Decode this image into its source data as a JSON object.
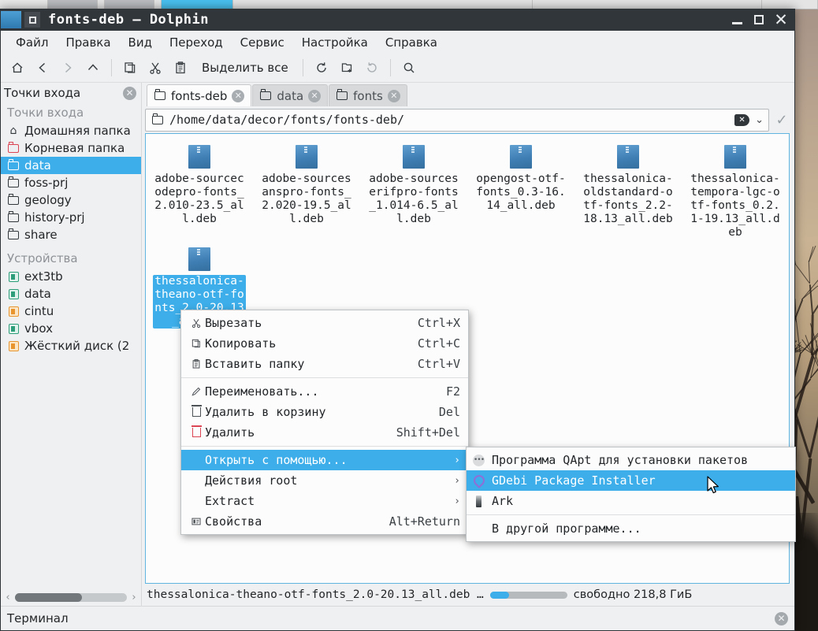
{
  "window": {
    "title": "fonts-deb — Dolphin",
    "app_icon": "dolphin-icon",
    "buttons": {
      "minimize": "_",
      "maximize": "▢",
      "close": "✕"
    }
  },
  "menubar": {
    "items": [
      "Файл",
      "Правка",
      "Вид",
      "Переход",
      "Сервис",
      "Настройка",
      "Справка"
    ]
  },
  "toolbar": {
    "items": [
      {
        "name": "home-icon",
        "glyph": "⌂",
        "dim": false
      },
      {
        "name": "back-icon",
        "glyph": "‹",
        "dim": false
      },
      {
        "name": "forward-icon",
        "glyph": "›",
        "dim": true
      },
      {
        "name": "up-icon",
        "glyph": "⌃",
        "dim": false
      }
    ],
    "items2": [
      {
        "name": "copy-icon",
        "glyph": "❐",
        "dim": false
      },
      {
        "name": "cut-icon",
        "glyph": "✂",
        "dim": false
      },
      {
        "name": "paste-icon",
        "glyph": "📋",
        "dim": false
      }
    ],
    "select_all_label": "Выделить все",
    "items3": [
      {
        "name": "reload-icon",
        "glyph": "⟳",
        "dim": false
      },
      {
        "name": "new-folder-icon",
        "glyph": "🗅",
        "dim": false
      },
      {
        "name": "undo-icon",
        "glyph": "↺",
        "dim": true
      }
    ],
    "items4": [
      {
        "name": "find-icon",
        "glyph": "⌕",
        "dim": false
      }
    ]
  },
  "sidebar": {
    "header": "Точки входа",
    "header_close": "✕",
    "sections": [
      {
        "title": "Точки входа",
        "items": [
          {
            "label": "Домашняя папка",
            "icon": "home-icon",
            "selected": false
          },
          {
            "label": "Корневая папка",
            "icon": "folder-red-icon",
            "selected": false
          },
          {
            "label": "data",
            "icon": "folder-icon",
            "selected": true
          },
          {
            "label": "foss-prj",
            "icon": "folder-icon",
            "selected": false
          },
          {
            "label": "geology",
            "icon": "folder-icon",
            "selected": false
          },
          {
            "label": "history-prj",
            "icon": "folder-icon",
            "selected": false
          },
          {
            "label": "share",
            "icon": "folder-icon",
            "selected": false
          }
        ]
      },
      {
        "title": "Устройства",
        "items": [
          {
            "label": "ext3tb",
            "icon": "drive-icon",
            "selected": false
          },
          {
            "label": "data",
            "icon": "drive-icon",
            "selected": false
          },
          {
            "label": "cintu",
            "icon": "drive-orange-icon",
            "selected": false
          },
          {
            "label": "vbox",
            "icon": "drive-icon",
            "selected": false
          },
          {
            "label": "Жёсткий диск (2",
            "icon": "drive-orange-icon",
            "selected": false
          }
        ]
      }
    ]
  },
  "tabs": [
    {
      "label": "fonts-deb",
      "active": true,
      "close": "✕"
    },
    {
      "label": "data",
      "active": false,
      "close": "✕"
    },
    {
      "label": "fonts",
      "active": false,
      "close": "✕"
    }
  ],
  "urlbar": {
    "path": "/home/data/decor/fonts/fonts-deb/",
    "folder_icon": "folder-icon",
    "clear_icon": "clear-icon",
    "dropdown_icon": "chevron-down-icon",
    "confirm_icon": "check-icon"
  },
  "files": [
    {
      "name": "adobe-sourcecodepro-fonts_2.010-23.5_all.deb",
      "selected": false
    },
    {
      "name": "adobe-sourcesanspro-fonts_2.020-19.5_all.deb",
      "selected": false
    },
    {
      "name": "adobe-sourceserifpro-fonts_1.014-6.5_all.deb",
      "selected": false
    },
    {
      "name": "opengost-otf-fonts_0.3-16.14_all.deb",
      "selected": false
    },
    {
      "name": "thessalonica-oldstandard-otf-fonts_2.2-18.13_all.deb",
      "selected": false
    },
    {
      "name": "thessalonica-tempora-lgc-otf-fonts_0.2.1-19.13_all.deb",
      "selected": false
    },
    {
      "name": "thessalonica-theano-otf-fonts_2.0-20.13_all.deb",
      "selected": true
    }
  ],
  "context_menu": {
    "groups": [
      [
        {
          "label": "Вырезать",
          "shortcut": "Ctrl+X",
          "icon": "cut-icon",
          "highlighted": false,
          "submenu": false
        },
        {
          "label": "Копировать",
          "shortcut": "Ctrl+C",
          "icon": "copy-icon",
          "highlighted": false,
          "submenu": false
        },
        {
          "label": "Вставить папку",
          "shortcut": "Ctrl+V",
          "icon": "paste-icon",
          "highlighted": false,
          "submenu": false
        }
      ],
      [
        {
          "label": "Переименовать...",
          "shortcut": "F2",
          "icon": "rename-pencil-icon",
          "highlighted": false,
          "submenu": false
        },
        {
          "label": "Удалить в корзину",
          "shortcut": "Del",
          "icon": "trash-icon",
          "highlighted": false,
          "submenu": false
        },
        {
          "label": "Удалить",
          "shortcut": "Shift+Del",
          "icon": "delete-red-trash-icon",
          "highlighted": false,
          "submenu": false
        }
      ],
      [
        {
          "label": "Открыть с помощью...",
          "shortcut": "",
          "icon": "",
          "highlighted": true,
          "submenu": true
        },
        {
          "label": "Действия root",
          "shortcut": "",
          "icon": "",
          "highlighted": false,
          "submenu": true
        },
        {
          "label": "Extract",
          "shortcut": "",
          "icon": "",
          "highlighted": false,
          "submenu": true
        },
        {
          "label": "Свойства",
          "shortcut": "Alt+Return",
          "icon": "properties-icon",
          "highlighted": false,
          "submenu": false
        }
      ]
    ]
  },
  "submenu": {
    "groups": [
      [
        {
          "label": "Программа QApt для установки пакетов",
          "icon": "qapt-icon",
          "highlighted": false
        },
        {
          "label": "GDebi Package Installer",
          "icon": "gdebi-icon",
          "highlighted": true
        },
        {
          "label": "Ark",
          "icon": "ark-icon",
          "highlighted": false
        }
      ],
      [
        {
          "label": "В другой программе...",
          "icon": "",
          "highlighted": false
        }
      ]
    ]
  },
  "statusbar": {
    "text": "thessalonica-theano-otf-fonts_2.0-20.13_all.deb …",
    "free_space": "свободно 218,8 ГиБ",
    "capacity_percent": 25
  },
  "terminal_dock": {
    "label": "Терминал",
    "close": "✕"
  },
  "colors": {
    "accent": "#3daee9",
    "titlebar": "#31363b",
    "window_bg": "#eff0f1",
    "view_bg": "#fcfcfc",
    "delete_red": "#da4453"
  }
}
